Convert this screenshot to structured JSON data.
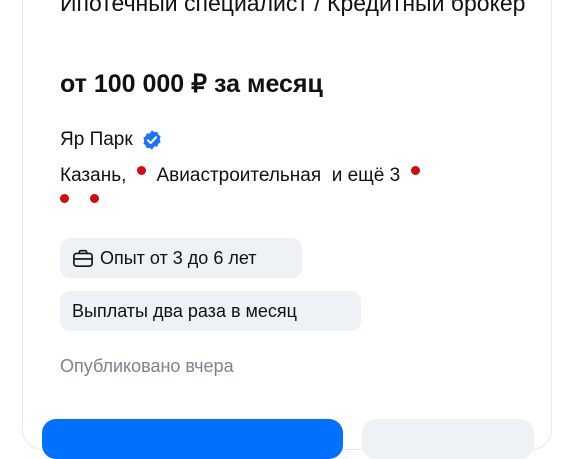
{
  "vacancy": {
    "title": "Ипотечный специалист / Кредитный брокер",
    "salary": "от 100 000 ₽ за месяц",
    "company": "Яр Парк",
    "city": "Казань,",
    "metro_station": "Авиастроительная",
    "more_stations": "и ещё 3",
    "metro_color": "#d20a11",
    "experience": "Опыт от 3 до 6 лет",
    "payouts": "Выплаты два раза в месяц",
    "published": "Опубликовано вчера"
  },
  "icons": {
    "verified": "verified-check-icon",
    "experience": "briefcase-icon"
  },
  "colors": {
    "accent": "#0070ff",
    "chip_bg": "#eef1f5",
    "muted_text": "#7b838f"
  }
}
